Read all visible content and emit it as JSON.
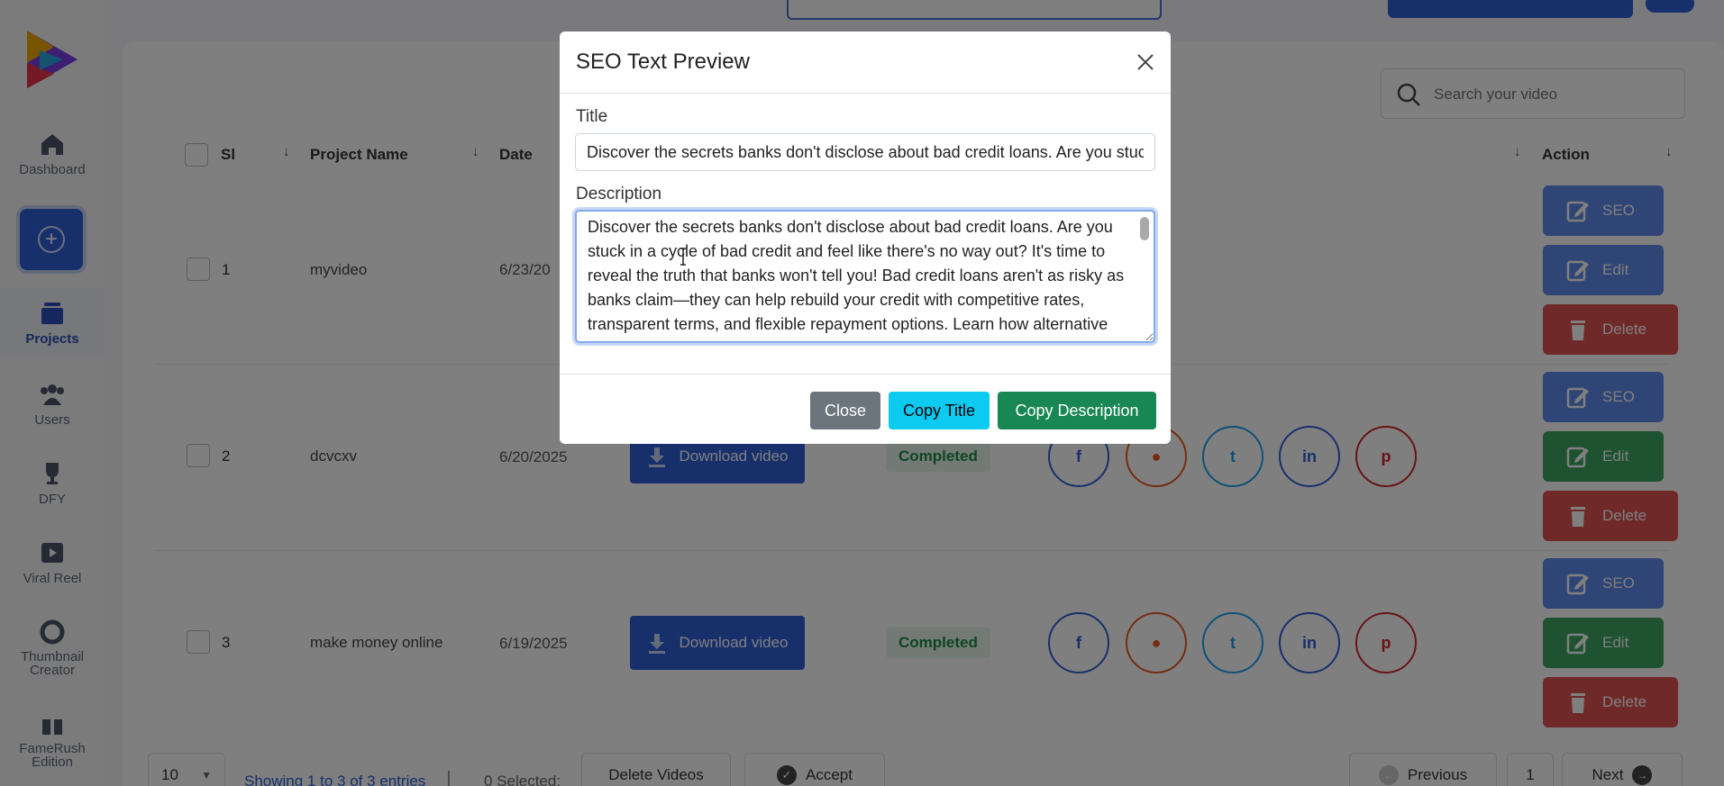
{
  "sidebar": {
    "items": [
      {
        "label": "Dashboard",
        "icon": "home-icon"
      },
      {
        "label": "Projects",
        "icon": "projects-icon"
      },
      {
        "label": "Users",
        "icon": "users-icon"
      },
      {
        "label": "DFY",
        "icon": "trophy-icon"
      },
      {
        "label": "Viral Reel",
        "icon": "reel-icon"
      },
      {
        "label": "Thumbnail Creator",
        "icon": "lifebuoy-icon"
      },
      {
        "label": "FameRush Edition",
        "icon": "gift-icon"
      }
    ],
    "create_icon": "plus-icon"
  },
  "search": {
    "placeholder": "Search your video"
  },
  "table": {
    "headers": {
      "sl": "Sl",
      "project_name": "Project Name",
      "date": "Date",
      "action": "Action"
    },
    "rows": [
      {
        "sl": "1",
        "name": "myvideo",
        "date": "6/23/20"
      },
      {
        "sl": "2",
        "name": "dcvcxv",
        "date": "6/20/2025",
        "download": "Download video",
        "status": "Completed"
      },
      {
        "sl": "3",
        "name": "make money online",
        "date": "6/19/2025",
        "download": "Download video",
        "status": "Completed"
      }
    ],
    "actions": {
      "seo": "SEO",
      "edit": "Edit",
      "delete": "Delete"
    }
  },
  "footer": {
    "page_size": "10",
    "showing": "Showing 1 to 3 of 3 entries",
    "selected": "0 Selected:",
    "delete_videos": "Delete Videos",
    "accept": "Accept",
    "previous": "Previous",
    "page": "1",
    "next": "Next"
  },
  "modal": {
    "title": "SEO Text Preview",
    "title_label": "Title",
    "title_value": "Discover the secrets banks don't disclose about bad credit loans. Are you stuck in a cycle of bad credit",
    "description_label": "Description",
    "description_value": "Discover the secrets banks don't disclose about bad credit loans. Are you stuck in a cycle of bad credit and feel like there's no way out? It's time to reveal the truth that banks won't tell you! Bad credit loans aren't as risky as banks claim—they can help rebuild your credit with competitive rates, transparent terms, and flexible repayment options. Learn how alternative lenders offer better approval odds and",
    "close_label": "Close",
    "copy_title_label": "Copy Title",
    "copy_description_label": "Copy Description"
  },
  "colors": {
    "primary": "#2f5fd6",
    "success": "#198754",
    "info": "#0dcaf0",
    "secondary": "#6c757d"
  }
}
